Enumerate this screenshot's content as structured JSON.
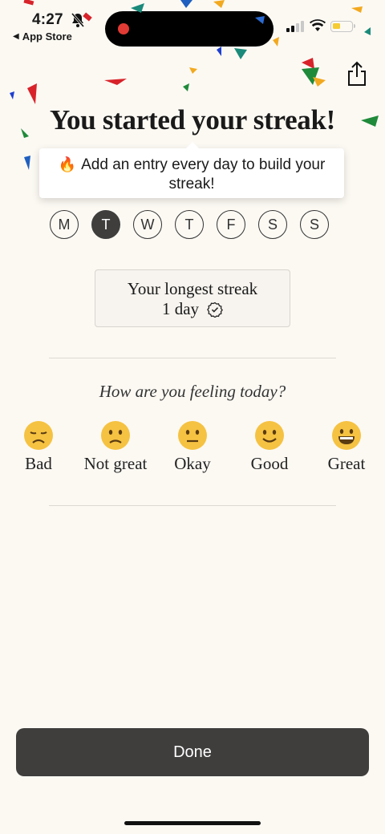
{
  "status_bar": {
    "time": "4:27",
    "back_label": "App Store"
  },
  "title": "You started your streak!",
  "tooltip": {
    "emoji": "🔥",
    "text": "Add an entry every day to build your streak!"
  },
  "week_days": [
    {
      "label": "M",
      "active": false
    },
    {
      "label": "T",
      "active": true
    },
    {
      "label": "W",
      "active": false
    },
    {
      "label": "T",
      "active": false
    },
    {
      "label": "F",
      "active": false
    },
    {
      "label": "S",
      "active": false
    },
    {
      "label": "S",
      "active": false
    }
  ],
  "streak": {
    "heading": "Your longest streak",
    "value": "1 day",
    "badge_icon": "verified-badge-icon"
  },
  "mood": {
    "question": "How are you feeling today?",
    "options": [
      {
        "label": "Bad",
        "icon": "sad-face-icon"
      },
      {
        "label": "Not great",
        "icon": "frown-face-icon"
      },
      {
        "label": "Okay",
        "icon": "neutral-face-icon"
      },
      {
        "label": "Good",
        "icon": "smile-face-icon"
      },
      {
        "label": "Great",
        "icon": "grin-face-icon"
      }
    ]
  },
  "done_label": "Done",
  "colors": {
    "background": "#fcf9f3",
    "button": "#3f3e3d",
    "emoji_yellow": "#f5c242"
  }
}
